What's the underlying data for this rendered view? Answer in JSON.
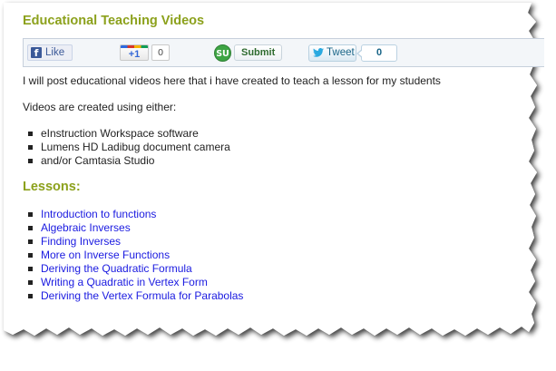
{
  "page": {
    "title": "Educational Teaching Videos",
    "intro": "I will post educational videos here that i have created to teach a lesson for my students",
    "tools_intro": "Videos are created using either:",
    "tools": [
      "eInstruction Workspace software",
      "Lumens HD Ladibug document camera",
      "and/or Camtasia Studio"
    ],
    "lessons_heading": "Lessons:",
    "lessons": [
      "Introduction to functions",
      "Algebraic Inverses",
      "Finding Inverses",
      "More on Inverse Functions",
      "Deriving the Quadratic Formula",
      "Writing a Quadratic in Vertex Form",
      "Deriving the Vertex Formula for Parabolas"
    ]
  },
  "share": {
    "facebook": {
      "icon": "facebook-f-icon",
      "label": "Like"
    },
    "google_plus": {
      "label": "+1",
      "count": "0"
    },
    "stumbleupon": {
      "icon": "stumbleupon-logo-icon",
      "logo_text": "SU",
      "label": "Submit"
    },
    "twitter": {
      "icon": "twitter-bird-icon",
      "label": "Tweet",
      "count": "0"
    }
  },
  "colors": {
    "heading": "#8ca11c",
    "link": "#1a1ae0",
    "share_bar_bg": "#f3f6f9",
    "facebook": "#3b5998",
    "stumbleupon": "#3ea544",
    "twitter_text": "#186487"
  }
}
